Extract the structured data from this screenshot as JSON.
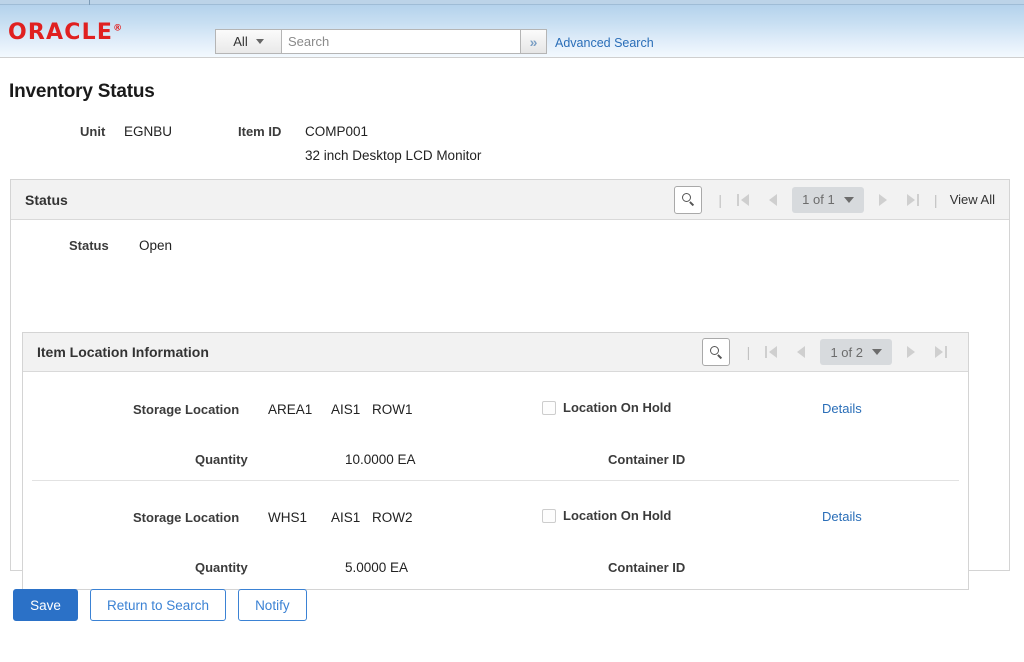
{
  "header": {
    "logo_text": "ORACLE",
    "logo_reg": "®",
    "search": {
      "scope_label": "All",
      "placeholder": "Search",
      "value": "",
      "go_label": "»",
      "advanced_label": "Advanced Search"
    }
  },
  "page": {
    "title": "Inventory Status"
  },
  "keys": {
    "unit_label": "Unit",
    "unit_value": "EGNBU",
    "item_label": "Item ID",
    "item_value": "COMP001",
    "item_description": "32 inch Desktop LCD Monitor"
  },
  "status_panel": {
    "title": "Status",
    "pager": {
      "search_icon": "magnifier-icon",
      "separator": "|",
      "first_icon": "first-page-icon",
      "prev_icon": "previous-page-icon",
      "page_label": "1 of 1",
      "next_icon": "next-page-icon",
      "last_icon": "last-page-icon",
      "view_all_label": "View All"
    },
    "status_field_label": "Status",
    "status_field_value": "Open"
  },
  "location_panel": {
    "title": "Item Location Information",
    "pager": {
      "search_icon": "magnifier-icon",
      "separator": "|",
      "first_icon": "first-page-icon",
      "prev_icon": "previous-page-icon",
      "page_label": "1 of 2",
      "next_icon": "next-page-icon",
      "last_icon": "last-page-icon"
    },
    "labels": {
      "storage_location": "Storage Location",
      "quantity": "Quantity",
      "location_on_hold": "Location On Hold",
      "container_id": "Container ID",
      "details": "Details"
    },
    "rows": [
      {
        "area": "AREA1",
        "aisle": "AIS1",
        "row": "ROW1",
        "quantity": "10.0000 EA",
        "on_hold": false,
        "container_id": "",
        "details_label": "Details"
      },
      {
        "area": "WHS1",
        "aisle": "AIS1",
        "row": "ROW2",
        "quantity": "5.0000 EA",
        "on_hold": false,
        "container_id": "",
        "details_label": "Details"
      }
    ]
  },
  "footer": {
    "save_label": "Save",
    "return_label": "Return to Search",
    "notify_label": "Notify"
  },
  "colors": {
    "brand_red": "#e02020",
    "link_blue": "#2a6eb8",
    "primary_button": "#2b71c7",
    "secondary_button_border": "#3b82d4",
    "panel_header_bg": "#f2f2f2",
    "pill_bg": "#d7dadd"
  }
}
